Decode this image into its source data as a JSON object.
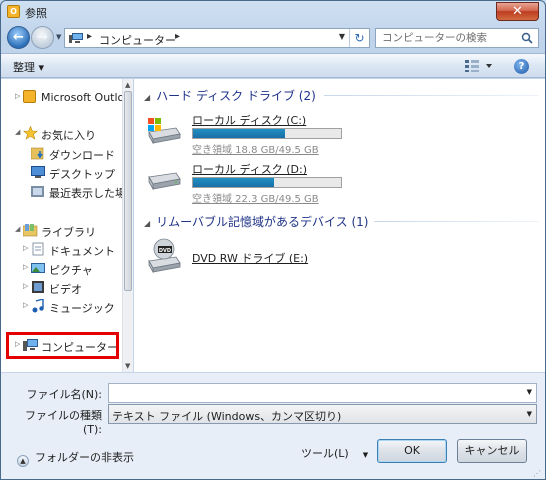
{
  "window": {
    "title": "参照",
    "close_glyph": "✕"
  },
  "address_bar": {
    "crumb_separator": "▸",
    "crumb_computer": "コンピューター",
    "crumb_trailing": "▸",
    "dropdown_glyph": "▼",
    "refresh_glyph": "↻"
  },
  "search": {
    "placeholder": "コンピューターの検索"
  },
  "toolbar": {
    "organize_label": "整理 ▾"
  },
  "nav_pane": {
    "items": [
      {
        "label": "Microsoft Outlook",
        "icon": "outlook-icon"
      },
      {
        "label": "お気に入り",
        "icon": "star-icon"
      },
      {
        "label": "ダウンロード",
        "icon": "download-folder-icon"
      },
      {
        "label": "デスクトップ",
        "icon": "desktop-icon"
      },
      {
        "label": "最近表示した場所",
        "icon": "recent-places-icon"
      },
      {
        "label": "ライブラリ",
        "icon": "library-icon"
      },
      {
        "label": "ドキュメント",
        "icon": "documents-icon"
      },
      {
        "label": "ピクチャ",
        "icon": "pictures-icon"
      },
      {
        "label": "ビデオ",
        "icon": "videos-icon"
      },
      {
        "label": "ミュージック",
        "icon": "music-icon"
      },
      {
        "label": "コンピューター",
        "icon": "computer-icon"
      }
    ]
  },
  "main": {
    "group_hdd": "ハード ディスク ドライブ (2)",
    "group_removable": "リムーバブル記憶域があるデバイス (1)",
    "drives": [
      {
        "name": "ローカル ディスク (C:)",
        "info": "空き領域 18.8 GB/49.5 GB",
        "used_fraction": 0.62
      },
      {
        "name": "ローカル ディスク (D:)",
        "info": "空き領域 22.3 GB/49.5 GB",
        "used_fraction": 0.55
      }
    ],
    "dvd": {
      "name": "DVD RW ドライブ (E:)"
    }
  },
  "form": {
    "filename_label": "ファイル名(N):",
    "filename_value": "",
    "filetype_label": "ファイルの種類(T):",
    "filetype_value": "テキスト ファイル (Windows、カンマ区切り)",
    "hide_folders_label": "フォルダーの非表示",
    "tools_label": "ツール(L)",
    "ok_label": "OK",
    "cancel_label": "キャンセル"
  },
  "colors": {
    "highlight_box": "#e40000",
    "bar_fill": "#1a7ab3",
    "group_header": "#1e3287"
  }
}
